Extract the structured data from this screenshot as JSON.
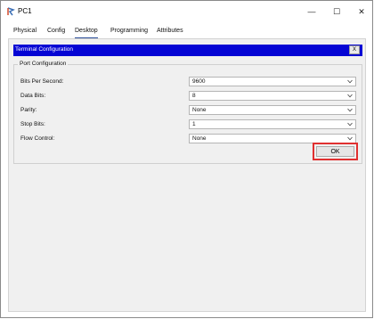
{
  "window": {
    "title": "PC1",
    "minimize_glyph": "—",
    "maximize_glyph": "☐",
    "close_glyph": "✕"
  },
  "tabs": [
    {
      "label": "Physical",
      "active": false
    },
    {
      "label": "Config",
      "active": false
    },
    {
      "label": "Desktop",
      "active": true
    },
    {
      "label": "Programming",
      "active": false
    },
    {
      "label": "Attributes",
      "active": false
    }
  ],
  "terminal": {
    "title": "Terminal Configuration",
    "close_label": "X",
    "header_color": "#0404d4"
  },
  "port_config": {
    "legend": "Port Configuration",
    "fields": [
      {
        "label": "Bits Per Second:",
        "value": "9600"
      },
      {
        "label": "Data Bits:",
        "value": "8"
      },
      {
        "label": "Parity:",
        "value": "None"
      },
      {
        "label": "Stop Bits:",
        "value": "1"
      },
      {
        "label": "Flow Control:",
        "value": "None"
      }
    ],
    "ok_label": "OK",
    "highlight_color": "#e03030"
  }
}
